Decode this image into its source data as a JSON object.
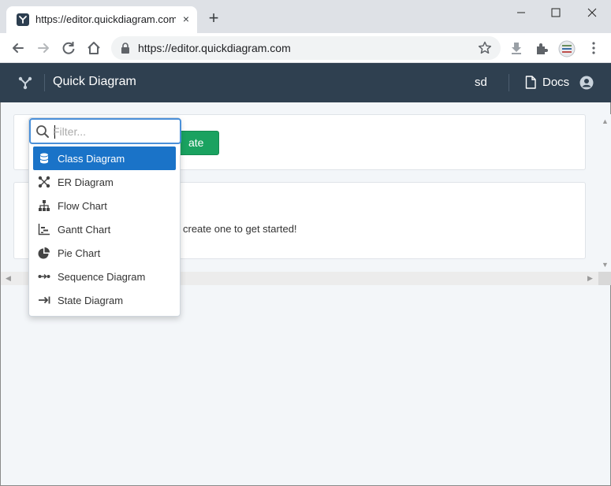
{
  "browser": {
    "tab_title": "https://editor.quickdiagram.com",
    "tab_close": "×",
    "new_tab": "+",
    "url": "https://editor.quickdiagram.com"
  },
  "app": {
    "title": "Quick Diagram",
    "user_initials": "sd",
    "docs_label": "Docs"
  },
  "page": {
    "create_button_label": "ate",
    "empty_message": "create one to get started!"
  },
  "dropdown": {
    "filter_placeholder": "Filter...",
    "filter_value": "",
    "items": [
      {
        "label": "Class Diagram",
        "icon": "database-icon",
        "active": true
      },
      {
        "label": "ER Diagram",
        "icon": "er-diagram-icon",
        "active": false
      },
      {
        "label": "Flow Chart",
        "icon": "sitemap-icon",
        "active": false
      },
      {
        "label": "Gantt Chart",
        "icon": "gantt-icon",
        "active": false
      },
      {
        "label": "Pie Chart",
        "icon": "pie-chart-icon",
        "active": false
      },
      {
        "label": "Sequence Diagram",
        "icon": "sequence-icon",
        "active": false
      },
      {
        "label": "State Diagram",
        "icon": "state-arrow-icon",
        "active": false
      }
    ]
  },
  "colors": {
    "header_bg": "#2f4050",
    "accent_blue": "#1a73c8",
    "create_green": "#1aa260"
  }
}
